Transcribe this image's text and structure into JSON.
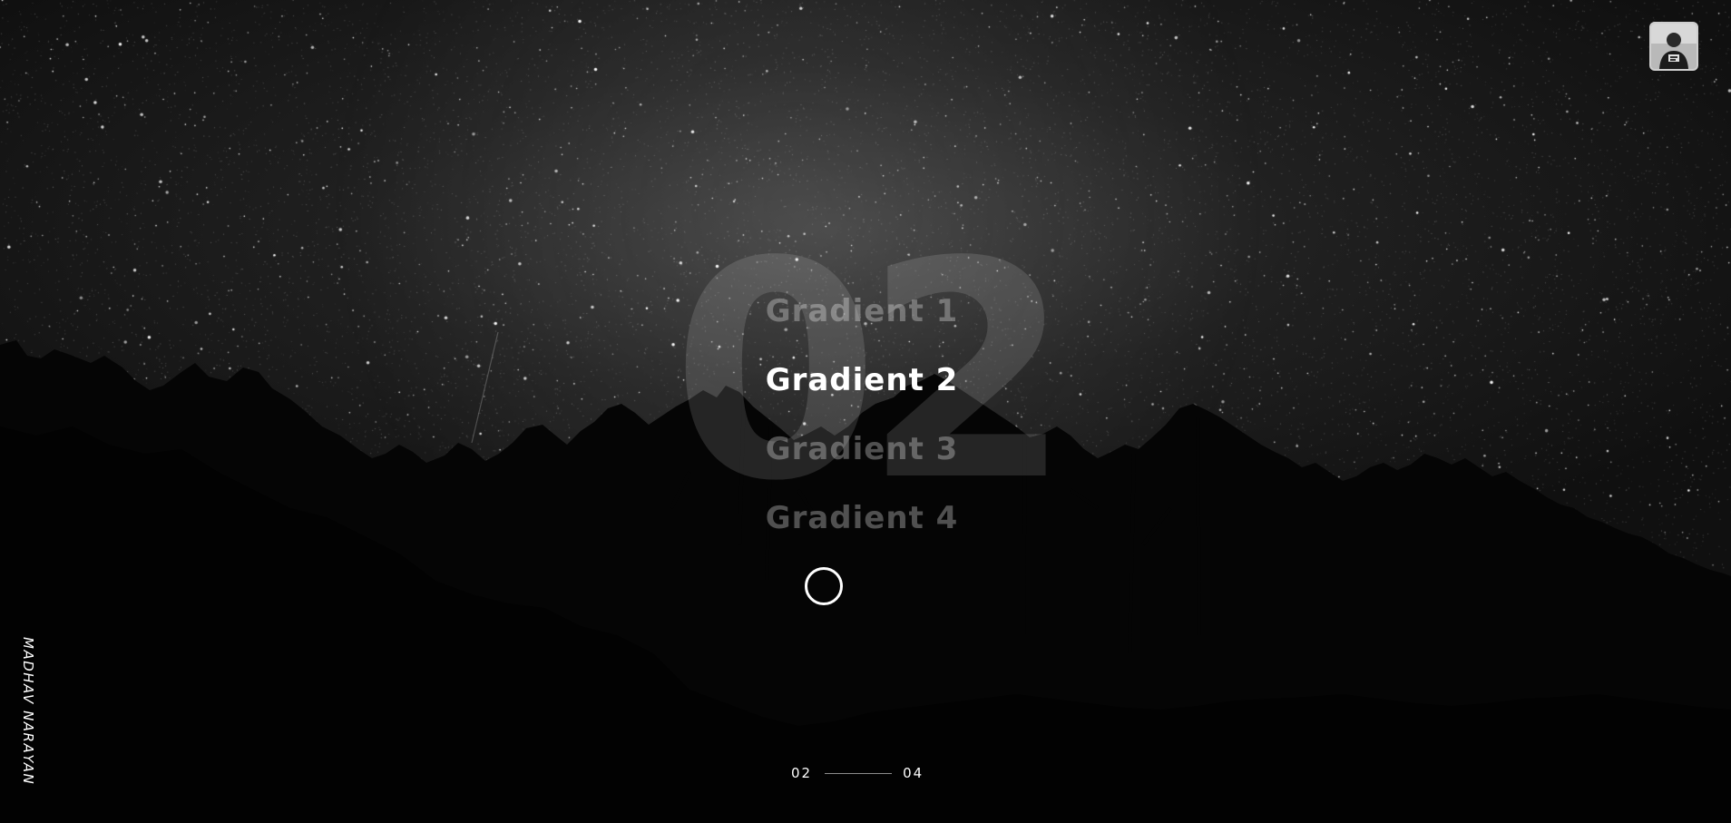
{
  "menu": {
    "items": [
      {
        "label": "Gradient 1"
      },
      {
        "label": "Gradient 2"
      },
      {
        "label": "Gradient 3"
      },
      {
        "label": "Gradient 4"
      }
    ],
    "active_index": 1
  },
  "big_number": "02",
  "pager": {
    "current": "02",
    "total": "04"
  },
  "author": "MADHAV NARAYAN",
  "avatar": {
    "icon": "profile-photo-icon"
  },
  "colors": {
    "text": "#ffffff",
    "inactive_text": "rgba(255,255,255,0.3)",
    "background": "#000000"
  }
}
